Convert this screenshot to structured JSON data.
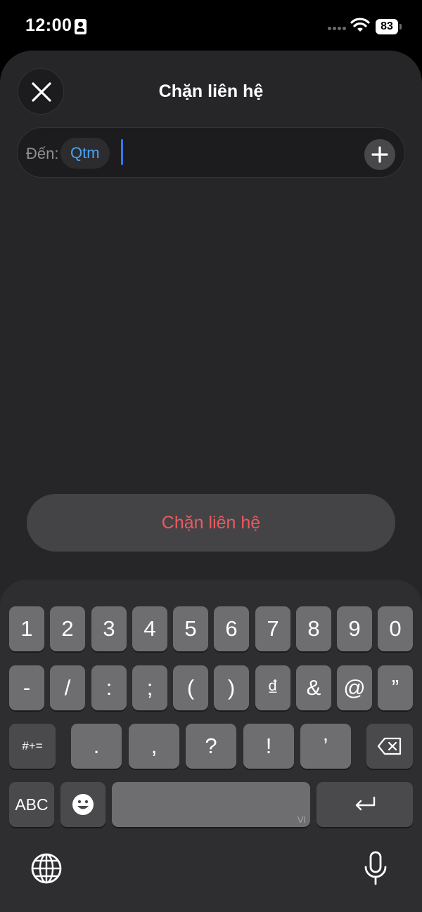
{
  "status_bar": {
    "time": "12:00",
    "battery": "83"
  },
  "sheet": {
    "title": "Chặn liên hệ"
  },
  "recipient_field": {
    "to_label": "Đến:",
    "recipient": "Qtm"
  },
  "actions": {
    "block_label": "Chặn liên hệ"
  },
  "keyboard": {
    "row1": [
      "1",
      "2",
      "3",
      "4",
      "5",
      "6",
      "7",
      "8",
      "9",
      "0"
    ],
    "row2": [
      "-",
      "/",
      ":",
      ";",
      "(",
      ")",
      "₫",
      "&",
      "@",
      "”"
    ],
    "row3_symbols_label": "#+=",
    "row3": [
      ".",
      ",",
      "?",
      "!",
      "’"
    ],
    "abc_label": "ABC",
    "space_language_tag": "VI",
    "icons": [
      "emoji-icon",
      "backspace-icon",
      "return-icon",
      "globe-icon",
      "microphone-icon"
    ]
  },
  "colors": {
    "accent_blue": "#4aa2f5",
    "destructive_red": "#ec5a5e",
    "cursor": "#3478f6"
  }
}
